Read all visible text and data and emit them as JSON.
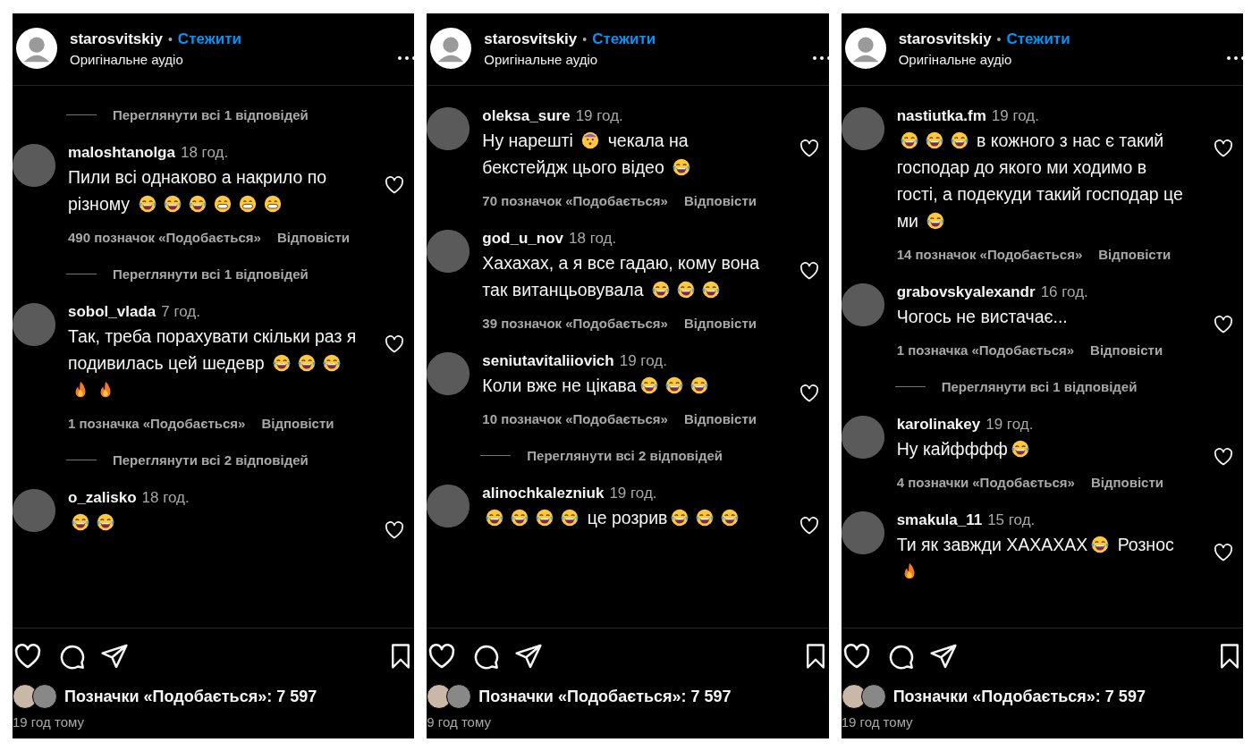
{
  "panels": [
    {
      "header": {
        "username": "starosvitskiy",
        "separator": "•",
        "follow": "Стежити",
        "subtitle": "Оригінальне аудіо"
      },
      "comments": [
        {
          "kind": "replies",
          "text": "Переглянути всі 1 відповідей"
        },
        {
          "kind": "comment",
          "user": "maloshtanolga",
          "time": "18 год.",
          "body": [
            {
              "kind": "text",
              "text": "Пили всі однаково а накрило по різному "
            },
            {
              "kind": "laugh"
            },
            {
              "kind": "laugh"
            },
            {
              "kind": "laugh"
            },
            {
              "kind": "grin"
            },
            {
              "kind": "grin"
            },
            {
              "kind": "grin"
            }
          ],
          "likes": "490 позначок «Подобається»",
          "reply": "Відповісти"
        },
        {
          "kind": "replies",
          "text": "Переглянути всі 1 відповідей"
        },
        {
          "kind": "comment",
          "user": "sobol_vlada",
          "time": "7 год.",
          "body": [
            {
              "kind": "text",
              "text": "Так, треба порахувати скільки раз я подивилась цей шедевр "
            },
            {
              "kind": "laugh"
            },
            {
              "kind": "laugh"
            },
            {
              "kind": "laugh"
            },
            {
              "kind": "fire"
            },
            {
              "kind": "fire"
            }
          ],
          "likes": "1 позначка «Подобається»",
          "reply": "Відповісти"
        },
        {
          "kind": "replies",
          "text": "Переглянути всі 2 відповідей"
        },
        {
          "kind": "comment",
          "user": "o_zalisko",
          "time": "18 год.",
          "body": [
            {
              "kind": "laugh"
            },
            {
              "kind": "laugh"
            }
          ]
        }
      ],
      "footer": {
        "likes": "Позначки «Подобається»: 7 597",
        "time": "19 год тому"
      }
    },
    {
      "header": {
        "username": "starosvitskiy",
        "separator": "•",
        "follow": "Стежити",
        "subtitle": "Оригінальне аудіо"
      },
      "comments": [
        {
          "kind": "comment",
          "user": "oleksa_sure",
          "time": "19 год.",
          "body": [
            {
              "kind": "text",
              "text": "Ну нарешті "
            },
            {
              "kind": "face"
            },
            {
              "kind": "text",
              "text": " чекала на бекстейдж цього відео "
            },
            {
              "kind": "laugh"
            }
          ],
          "likes": "70 позначок «Подобається»",
          "reply": "Відповісти"
        },
        {
          "kind": "comment",
          "user": "god_u_nov",
          "time": "18 год.",
          "body": [
            {
              "kind": "text",
              "text": "Хахахах, а я все гадаю, кому вона так витанцьовувала "
            },
            {
              "kind": "laugh"
            },
            {
              "kind": "laugh"
            },
            {
              "kind": "laugh"
            }
          ],
          "likes": "39 позначок «Подобається»",
          "reply": "Відповісти"
        },
        {
          "kind": "comment",
          "user": "seniutavitaliiovich",
          "time": "19 год.",
          "body": [
            {
              "kind": "text",
              "text": "Коли вже не цікава"
            },
            {
              "kind": "laugh"
            },
            {
              "kind": "laugh"
            },
            {
              "kind": "laugh"
            }
          ],
          "likes": "10 позначок «Подобається»",
          "reply": "Відповісти"
        },
        {
          "kind": "replies",
          "text": "Переглянути всі 2 відповідей"
        },
        {
          "kind": "comment",
          "user": "alinochkalezniuk",
          "time": "19 год.",
          "body": [
            {
              "kind": "laugh"
            },
            {
              "kind": "laugh"
            },
            {
              "kind": "laugh"
            },
            {
              "kind": "laugh"
            },
            {
              "kind": "text",
              "text": " це розрив"
            },
            {
              "kind": "laugh"
            },
            {
              "kind": "laugh"
            },
            {
              "kind": "laugh"
            }
          ]
        }
      ],
      "footer": {
        "likes": "Позначки «Подобається»: 7 597",
        "time": "9 год тому"
      }
    },
    {
      "header": {
        "username": "starosvitskiy",
        "separator": "•",
        "follow": "Стежити",
        "subtitle": "Оригінальне аудіо"
      },
      "comments": [
        {
          "kind": "comment",
          "user": "nastiutka.fm",
          "time": "19 год.",
          "body": [
            {
              "kind": "laugh"
            },
            {
              "kind": "laugh"
            },
            {
              "kind": "laugh"
            },
            {
              "kind": "text",
              "text": " в кожного з нас є такий господар до якого ми ходимо в гості, а подекуди такий господар це ми "
            },
            {
              "kind": "laugh"
            }
          ],
          "likes": "14 позначок «Подобається»",
          "reply": "Відповісти"
        },
        {
          "kind": "comment",
          "user": "grabovskyalexandr",
          "time": "16 год.",
          "body": [
            {
              "kind": "text",
              "text": "Чогось не вистачає..."
            }
          ],
          "likes": "1 позначка «Подобається»",
          "reply": "Відповісти"
        },
        {
          "kind": "replies",
          "text": "Переглянути всі 1 відповідей"
        },
        {
          "kind": "comment",
          "user": "karolinakey",
          "time": "19 год.",
          "body": [
            {
              "kind": "text",
              "text": "Ну кайфффф"
            },
            {
              "kind": "laugh"
            }
          ],
          "likes": "4 позначки «Подобається»",
          "reply": "Відповісти"
        },
        {
          "kind": "comment",
          "user": "smakula_11",
          "time": "15 год.",
          "body": [
            {
              "kind": "text",
              "text": "Ти як завжди ХАХАХАХ"
            },
            {
              "kind": "laugh"
            },
            {
              "kind": "text",
              "text": " Рознос "
            },
            {
              "kind": "fire"
            }
          ]
        }
      ],
      "footer": {
        "likes": "Позначки «Подобається»: 7 597",
        "time": "19 год тому"
      }
    }
  ]
}
